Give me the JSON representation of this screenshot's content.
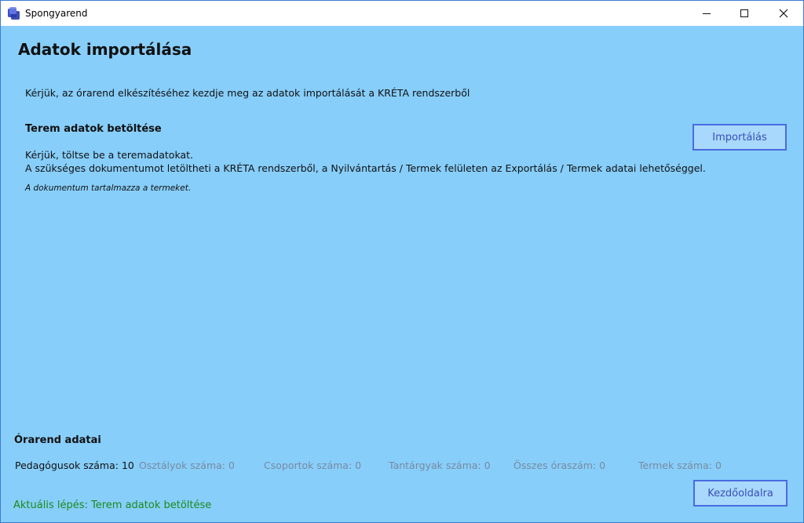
{
  "window": {
    "title": "Spongyarend"
  },
  "page": {
    "title": "Adatok importálása",
    "intro": "Kérjük, az órarend elkészítéséhez kezdje meg az adatok importálását a KRÉTA rendszerből"
  },
  "section": {
    "title": "Terem adatok betöltése",
    "line1": "Kérjük, töltse be a teremadatokat.",
    "line2": "A szükséges dokumentumot letöltheti a KRÉTA rendszerből, a Nyilvántartás / Termek felületen az Exportálás / Termek adatai lehetőséggel.",
    "note": "A dokumentum tartalmazza a termeket.",
    "import_button": "Importálás"
  },
  "timetable": {
    "title": "Órarend adatai",
    "stats": [
      {
        "label": "Pedagógusok száma: 10",
        "active": true
      },
      {
        "label": "Osztályok száma: 0",
        "active": false
      },
      {
        "label": "Csoportok száma: 0",
        "active": false
      },
      {
        "label": "Tantárgyak száma: 0",
        "active": false
      },
      {
        "label": "Összes óraszám: 0",
        "active": false
      },
      {
        "label": "Termek száma: 0",
        "active": false
      }
    ]
  },
  "footer": {
    "status": "Aktuális lépés: Terem adatok betöltése",
    "home_button": "Kezdőoldalra"
  },
  "colors": {
    "background": "#87CEFA",
    "button_border": "#4a6be0",
    "status_text": "#1b8a1b"
  },
  "icons": {
    "app": "app-logo-icon",
    "minimize": "minimize-icon",
    "maximize": "maximize-icon",
    "close": "close-icon"
  }
}
